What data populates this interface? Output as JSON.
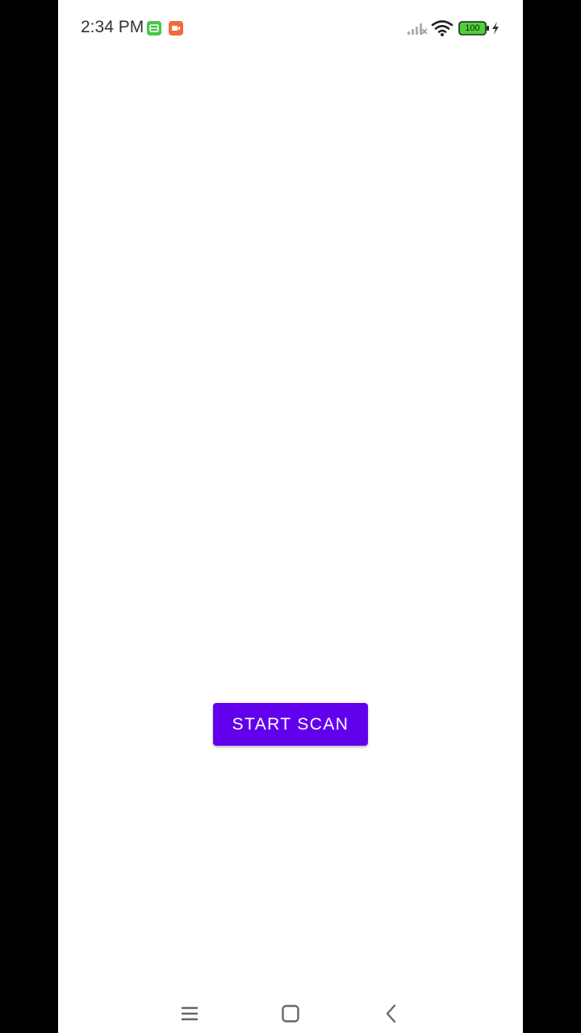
{
  "status_bar": {
    "time": "2:34 PM",
    "battery_level": "100",
    "icons": [
      "green-app-notification-icon",
      "orange-video-notification-icon",
      "signal-off-icon",
      "wifi-icon",
      "battery-icon",
      "charging-bolt-icon"
    ],
    "colors": {
      "notif_green": "#4cc34e",
      "notif_orange": "#f26b3a",
      "battery_fill": "#4cd137"
    }
  },
  "main": {
    "start_button_label": "START SCAN",
    "accent_color": "#6200ee"
  },
  "nav_bar": {
    "icons": [
      "menu-icon",
      "home-icon",
      "back-icon"
    ]
  }
}
